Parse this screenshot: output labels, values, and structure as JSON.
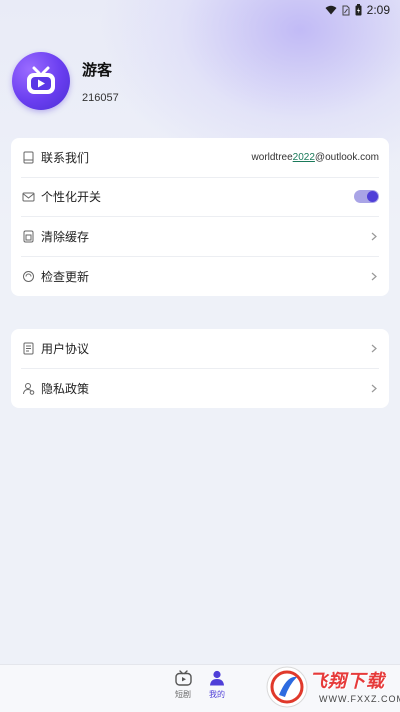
{
  "status_bar": {
    "time": "2:09"
  },
  "profile": {
    "name": "游客",
    "id": "216057"
  },
  "settings_card": {
    "items": [
      {
        "label": "联系我们",
        "value_prefix": "worldtree",
        "value_highlight": "2022",
        "value_suffix": "@outlook.com",
        "icon": "contact-icon"
      },
      {
        "label": "个性化开关",
        "toggle_on": true,
        "icon": "mail-icon"
      },
      {
        "label": "清除缓存",
        "icon": "storage-icon"
      },
      {
        "label": "检查更新",
        "icon": "refresh-icon"
      }
    ]
  },
  "legal_card": {
    "items": [
      {
        "label": "用户协议",
        "icon": "document-icon"
      },
      {
        "label": "隐私政策",
        "icon": "privacy-icon"
      }
    ]
  },
  "tabbar": {
    "tabs": [
      {
        "label": "短剧",
        "active": false
      },
      {
        "label": "我的",
        "active": true
      }
    ],
    "active_color": "#4f3fd8",
    "inactive_color": "#666666"
  },
  "watermark": {
    "title": "飞翔下载",
    "url": "WWW.FXXZ.COM"
  }
}
